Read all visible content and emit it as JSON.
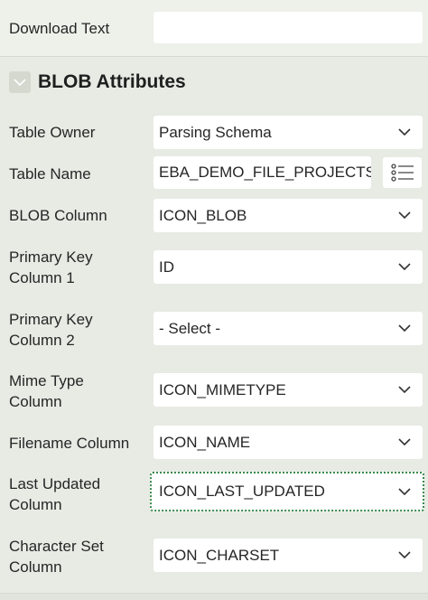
{
  "download_text": {
    "label": "Download Text",
    "value": ""
  },
  "section": {
    "title": "BLOB Attributes",
    "toggle_icon": "chevron-down-icon"
  },
  "fields": {
    "table_owner": {
      "label": "Table Owner",
      "value": "Parsing Schema"
    },
    "table_name": {
      "label": "Table Name",
      "value": "EBA_DEMO_FILE_PROJECTS",
      "button_icon": "list-icon"
    },
    "blob_column": {
      "label": "BLOB Column",
      "value": "ICON_BLOB"
    },
    "pk1": {
      "label_line1": "Primary Key",
      "label_line2": "Column 1",
      "value": "ID"
    },
    "pk2": {
      "label_line1": "Primary Key",
      "label_line2": "Column 2",
      "value": "- Select -"
    },
    "mime": {
      "label_line1": "Mime Type",
      "label_line2": "Column",
      "value": "ICON_MIMETYPE"
    },
    "filename": {
      "label": "Filename Column",
      "value": "ICON_NAME"
    },
    "last_updated": {
      "label_line1": "Last Updated",
      "label_line2": "Column",
      "value": "ICON_LAST_UPDATED"
    },
    "charset": {
      "label_line1": "Character Set",
      "label_line2": "Column",
      "value": "ICON_CHARSET"
    }
  },
  "colors": {
    "panel_bg": "#e8ebe4",
    "field_bg": "#ffffff",
    "focus": "#3b8a4c"
  }
}
